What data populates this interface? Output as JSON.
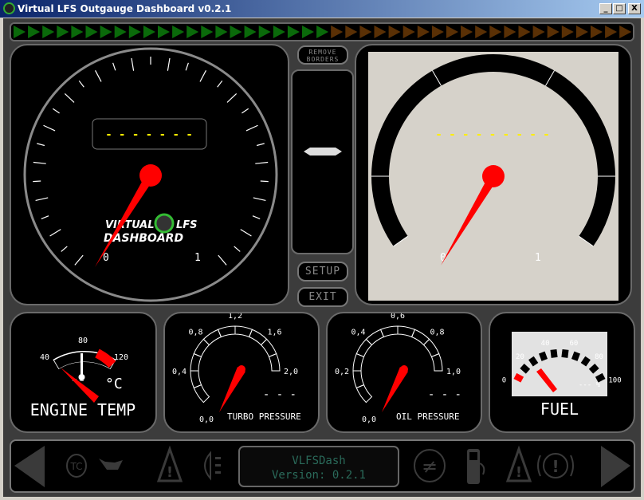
{
  "window": {
    "title": "Virtual LFS Outgauge Dashboard v0.2.1",
    "minimize": "_",
    "maximize": "□",
    "close": "X"
  },
  "shift_lights": {
    "green_count": 22,
    "orange_count": 21,
    "green": "#0a6a0a",
    "orange": "#5a3005"
  },
  "tachometer": {
    "display": "- - - - - - -",
    "scale_min": "0",
    "scale_max": "1",
    "logo_line1": "VIRTUAL LFS",
    "logo_line2": "DASHBOARD",
    "needle_color": "#ff0000"
  },
  "controls": {
    "remove_borders": "REMOVE BORDERS",
    "setup": "SETUP",
    "exit": "EXIT",
    "gear": "-"
  },
  "speedometer": {
    "display": "- - - - - - - - -",
    "scale_min": "0",
    "scale_max": "1",
    "face_color": "#d6d2ca"
  },
  "engine_temp": {
    "title": "ENGINE TEMP",
    "unit": "°C",
    "ticks": [
      "40",
      "80",
      "120"
    ]
  },
  "turbo": {
    "title": "TURBO PRESSURE",
    "value": "- - -",
    "ticks": [
      "0,0",
      "0,4",
      "0,8",
      "1,2",
      "1,6",
      "2,0"
    ]
  },
  "oil": {
    "title": "OIL PRESSURE",
    "value": "- - -",
    "ticks": [
      "0,0",
      "0,2",
      "0,4",
      "0,6",
      "0,8",
      "1,0"
    ]
  },
  "fuel": {
    "title": "FUEL",
    "value": "--- %",
    "ticks": [
      "0",
      "20",
      "40",
      "60",
      "80",
      "100"
    ]
  },
  "status_bar": {
    "lcd_line1": "VLFSDash",
    "lcd_line2": "Version: 0.2.1",
    "icons": [
      "left-arrow",
      "traction-control",
      "oil-can",
      "warning",
      "headlight",
      "handbrake",
      "fuel-pump",
      "warning",
      "abs",
      "right-arrow"
    ]
  }
}
